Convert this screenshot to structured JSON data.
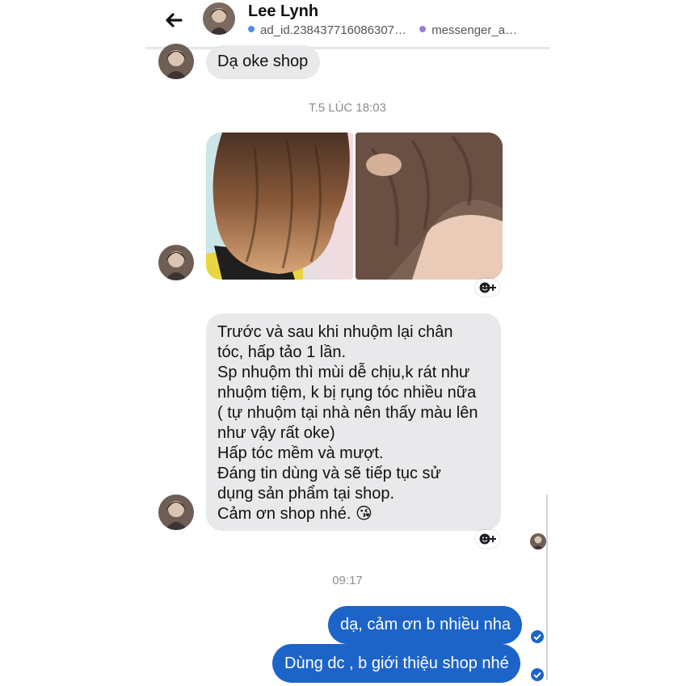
{
  "header": {
    "contact_name": "Lee Lynh",
    "tags": [
      "ad_id.238437716086307…",
      "messenger_a…"
    ]
  },
  "colors": {
    "outgoing_bubble": "#1d64c8",
    "incoming_bubble": "#e9e9eb",
    "tag_blue": "#4a90e2",
    "tag_purple": "#9b7bd3"
  },
  "icons": [
    "back-arrow-icon",
    "add-reaction-icon",
    "sent-check-icon"
  ],
  "messages": {
    "m1": "Dạ oke shop",
    "ts1": "T.5 LÚC 18:03",
    "m2_lines": [
      "Trước và sau khi nhuộm lại chân",
      "tóc, hấp tảo 1 lần.",
      "Sp nhuộm thì mùi dễ chịu,k rát như",
      "nhuộm tiệm, k bị rụng tóc nhiều nữa",
      "( tự nhuộm tại nhà nên thấy màu lên",
      "như vậy rất oke)",
      "Hấp tóc mềm và mượt.",
      "Đáng tin dùng và sẽ tiếp tục sử",
      "dụng sản phẩm tại shop.",
      "Cảm ơn shop nhé. 😘"
    ],
    "ts2": "09:17",
    "out1": "dạ, cảm ơn b nhiều nha",
    "out2": "Dùng dc , b giới thiệu shop nhé"
  }
}
